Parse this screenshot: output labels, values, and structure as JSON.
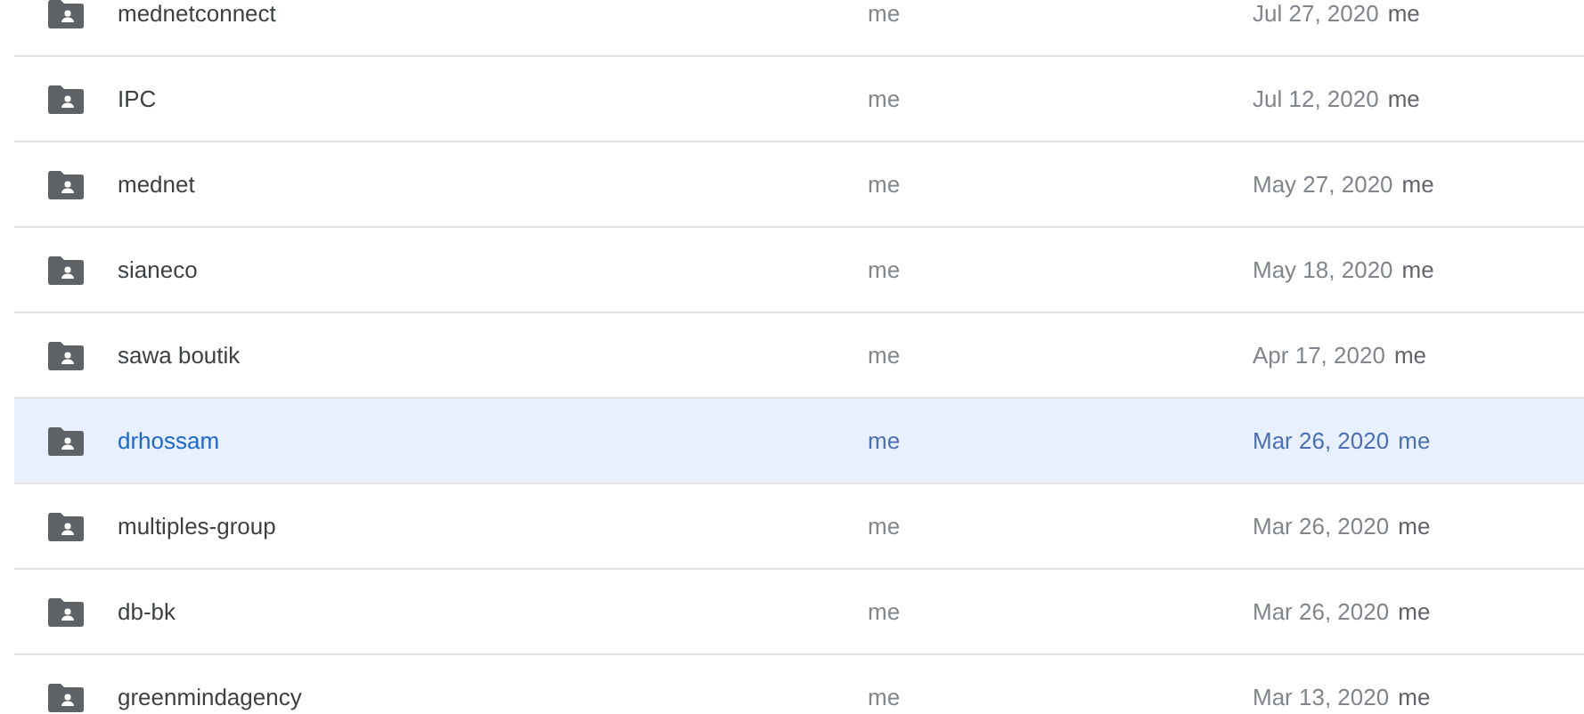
{
  "rows": [
    {
      "name": "mednetconnect",
      "owner": "me",
      "modified": "Jul 27, 2020",
      "modified_by": "me",
      "selected": false
    },
    {
      "name": "IPC",
      "owner": "me",
      "modified": "Jul 12, 2020",
      "modified_by": "me",
      "selected": false
    },
    {
      "name": "mednet",
      "owner": "me",
      "modified": "May 27, 2020",
      "modified_by": "me",
      "selected": false
    },
    {
      "name": "sianeco",
      "owner": "me",
      "modified": "May 18, 2020",
      "modified_by": "me",
      "selected": false
    },
    {
      "name": "sawa boutik",
      "owner": "me",
      "modified": "Apr 17, 2020",
      "modified_by": "me",
      "selected": false
    },
    {
      "name": "drhossam",
      "owner": "me",
      "modified": "Mar 26, 2020",
      "modified_by": "me",
      "selected": true
    },
    {
      "name": "multiples-group",
      "owner": "me",
      "modified": "Mar 26, 2020",
      "modified_by": "me",
      "selected": false
    },
    {
      "name": "db-bk",
      "owner": "me",
      "modified": "Mar 26, 2020",
      "modified_by": "me",
      "selected": false
    },
    {
      "name": "greenmindagency",
      "owner": "me",
      "modified": "Mar 13, 2020",
      "modified_by": "me",
      "selected": false
    }
  ]
}
